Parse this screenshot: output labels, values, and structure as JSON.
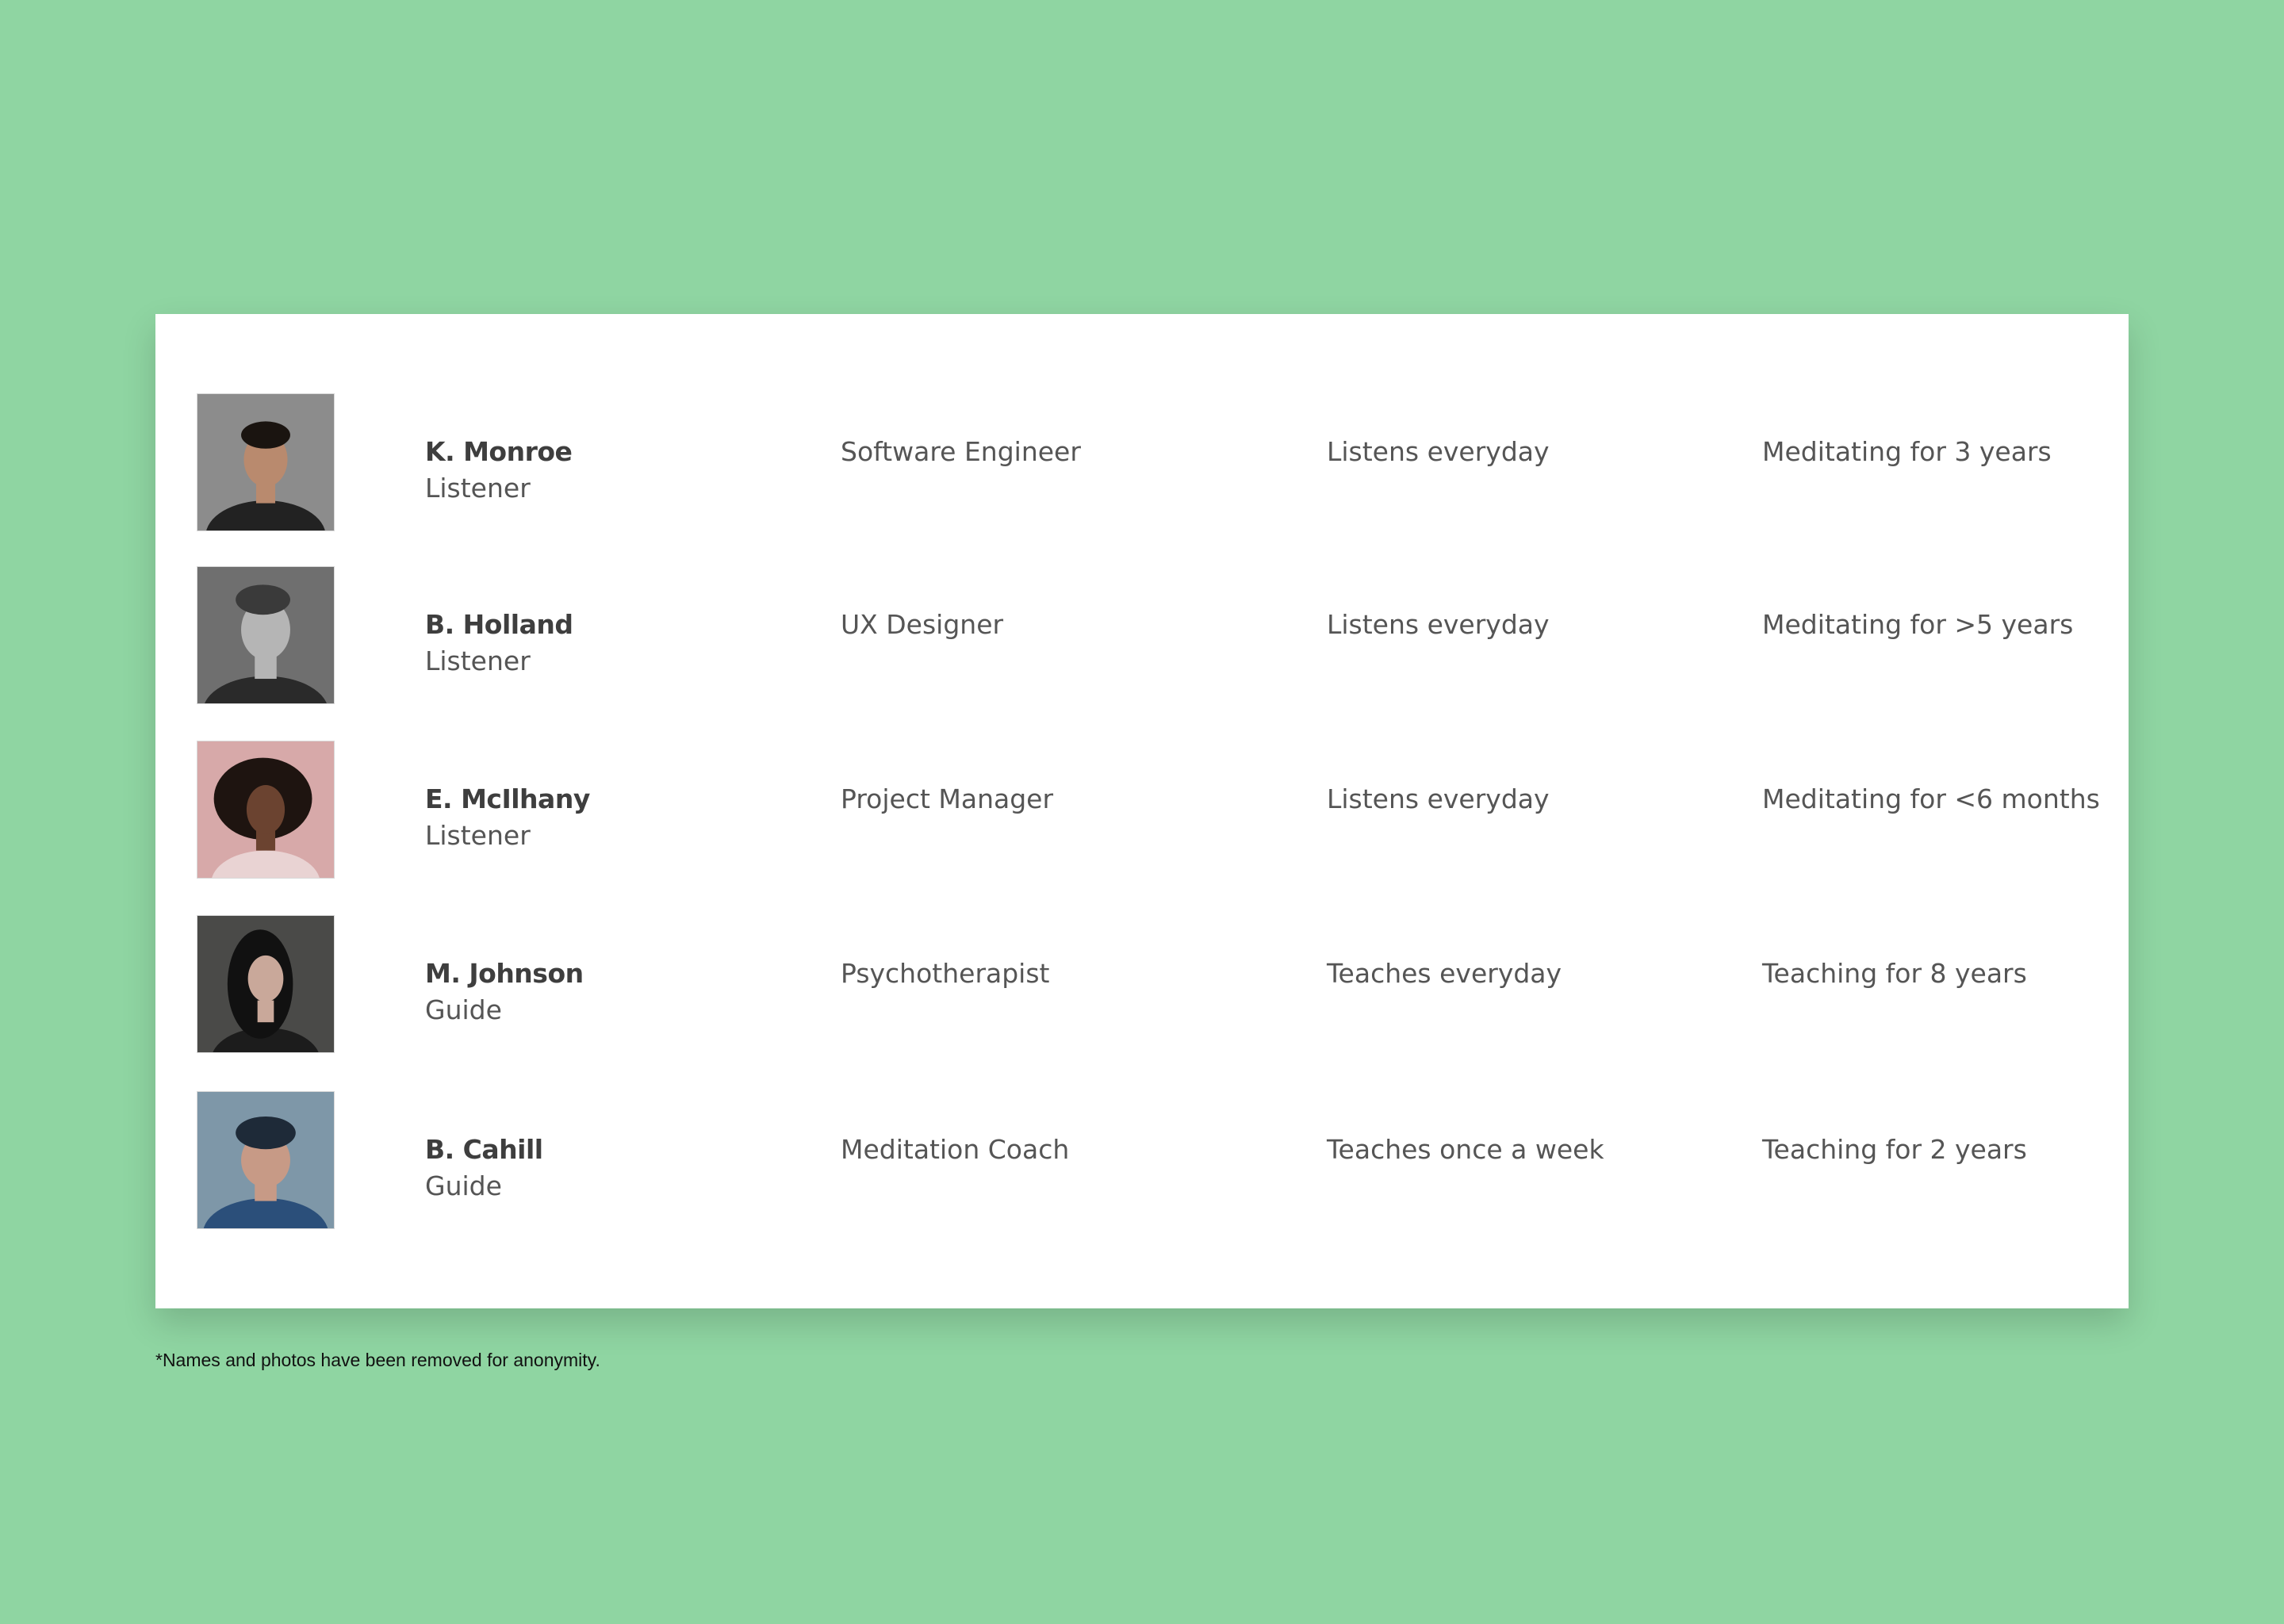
{
  "people": [
    {
      "name": "K. Monroe",
      "role": "Listener",
      "occupation": "Software Engineer",
      "frequency": "Listens everyday",
      "experience": "Meditating for 3 years",
      "photo_bg": "#8c8c8c",
      "photo_hair": "#1a1410",
      "photo_skin": "#b98a6e",
      "photo_shirt": "#222222"
    },
    {
      "name": "B. Holland",
      "role": "Listener",
      "occupation": "UX Designer",
      "frequency": "Listens everyday",
      "experience": "Meditating for >5 years",
      "photo_bg": "#6f6f6f",
      "photo_hair": "#3a3a3a",
      "photo_skin": "#b5b5b5",
      "photo_shirt": "#2a2a2a"
    },
    {
      "name": "E. McIlhany",
      "role": "Listener",
      "occupation": "Project Manager",
      "frequency": "Listens everyday",
      "experience": "Meditating for <6 months",
      "photo_bg": "#d7a9a9",
      "photo_hair": "#1e1410",
      "photo_skin": "#6b4330",
      "photo_shirt": "#e9d3d3"
    },
    {
      "name": "M. Johnson",
      "role": "Guide",
      "occupation": "Psychotherapist",
      "frequency": "Teaches everyday",
      "experience": "Teaching for 8 years",
      "photo_bg": "#4a4a48",
      "photo_hair": "#111111",
      "photo_skin": "#c9a89a",
      "photo_shirt": "#1c1c1c"
    },
    {
      "name": "B. Cahill",
      "role": "Guide",
      "occupation": "Meditation Coach",
      "frequency": "Teaches once a week",
      "experience": "Teaching for 2 years",
      "photo_bg": "#7e97a8",
      "photo_hair": "#1e2a38",
      "photo_skin": "#c79a86",
      "photo_shirt": "#2b4f7a"
    }
  ],
  "footnote": "*Names and photos have been removed for anonymity.",
  "colors": {
    "background": "#8fd5a2",
    "card": "#ffffff",
    "name_text": "#3e3e3e",
    "body_text": "#555555"
  }
}
